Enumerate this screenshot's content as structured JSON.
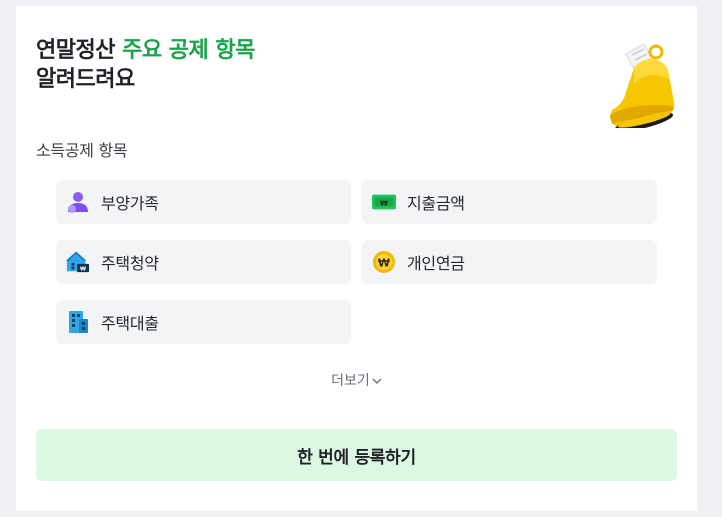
{
  "headline": {
    "prefix": "연말정산 ",
    "accent": "주요 공제 항목",
    "line2": "알려드려요"
  },
  "section_title": "소득공제 항목",
  "items": [
    {
      "label": "부양가족",
      "icon": "person-icon"
    },
    {
      "label": "지출금액",
      "icon": "money-bill-icon"
    },
    {
      "label": "주택청약",
      "icon": "house-savings-icon"
    },
    {
      "label": "개인연금",
      "icon": "won-coin-icon"
    },
    {
      "label": "주택대출",
      "icon": "building-icon"
    }
  ],
  "more_label": "더보기",
  "register_label": "한 번에 등록하기",
  "colors": {
    "accent": "#1aa34a",
    "button_bg": "#ddf8e2",
    "item_bg": "#f2f4f6"
  }
}
